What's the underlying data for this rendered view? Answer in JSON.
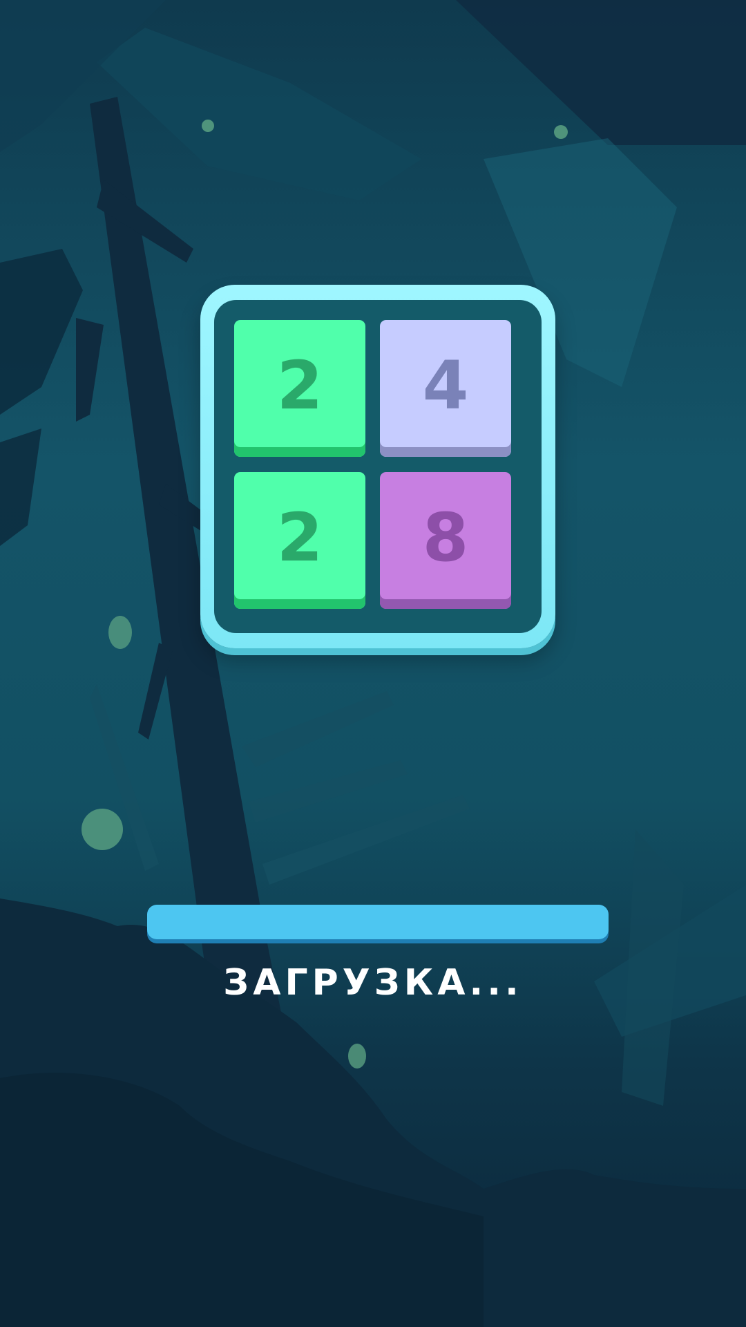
{
  "app": {
    "screen": "loading"
  },
  "logo": {
    "tiles": [
      {
        "value": "2",
        "color": "#50ffab"
      },
      {
        "value": "4",
        "color": "#c6ccff"
      },
      {
        "value": "2",
        "color": "#50ffab"
      },
      {
        "value": "8",
        "color": "#c77fe1"
      }
    ],
    "frame_color": "#7de7f6"
  },
  "loading": {
    "label": "ЗАГРУЗКА...",
    "progress": 1.0,
    "bar_color": "#4dc6f1"
  }
}
